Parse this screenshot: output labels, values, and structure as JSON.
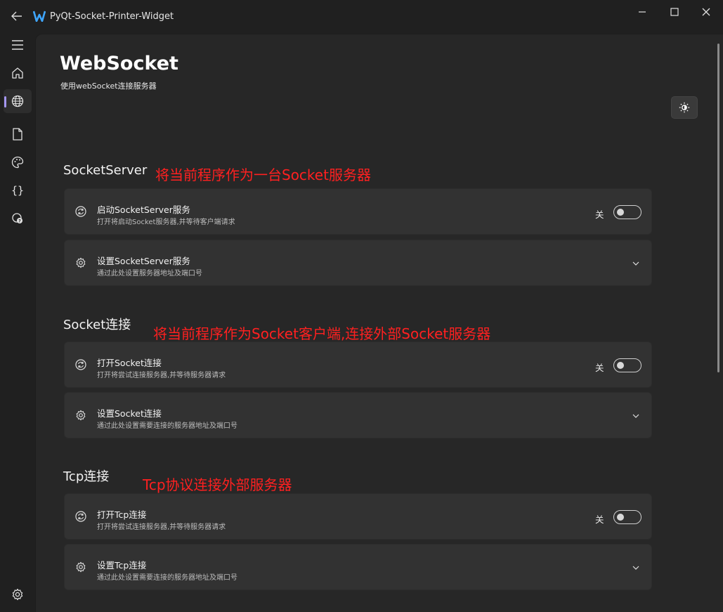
{
  "window": {
    "title": "PyQt-Socket-Printer-Widget",
    "controls": [
      "minimize-icon",
      "maximize-icon",
      "close-icon"
    ]
  },
  "nav": {
    "items": [
      {
        "icon": "menu-icon"
      },
      {
        "icon": "home-icon"
      },
      {
        "icon": "globe-icon",
        "active": true
      },
      {
        "icon": "document-icon"
      },
      {
        "icon": "palette-icon"
      },
      {
        "icon": "code-braces-icon"
      },
      {
        "icon": "chat-help-icon"
      }
    ],
    "bottom": {
      "icon": "settings-icon"
    },
    "accent": "#a597f2"
  },
  "page": {
    "title": "WebSocket",
    "subtitle": "使用webSocket连接服务器",
    "theme_button_icon": "brightness-icon"
  },
  "sections": [
    {
      "title": "SocketServer",
      "annotation": "将当前程序作为一台Socket服务器",
      "cards": [
        {
          "icon": "sync-icon",
          "title": "启动SocketServer服务",
          "desc": "打开将启动Socket服务器,并等待客户端请求",
          "control": "toggle",
          "toggle_label": "关",
          "on": false
        },
        {
          "icon": "gear-icon",
          "title": "设置SocketServer服务",
          "desc": "通过此处设置服务器地址及端口号",
          "control": "expand"
        }
      ]
    },
    {
      "title": "Socket连接",
      "annotation": "将当前程序作为Socket客户端,连接外部Socket服务器",
      "cards": [
        {
          "icon": "sync-icon",
          "title": "打开Socket连接",
          "desc": "打开将尝试连接服务器,并等待服务器请求",
          "control": "toggle",
          "toggle_label": "关",
          "on": false
        },
        {
          "icon": "gear-icon",
          "title": "设置Socket连接",
          "desc": "通过此处设置需要连接的服务器地址及端口号",
          "control": "expand"
        }
      ]
    },
    {
      "title": "Tcp连接",
      "annotation": "Tcp协议连接外部服务器",
      "cards": [
        {
          "icon": "sync-icon",
          "title": "打开Tcp连接",
          "desc": "打开将尝试连接服务器,并等待服务器请求",
          "control": "toggle",
          "toggle_label": "关",
          "on": false
        },
        {
          "icon": "gear-icon",
          "title": "设置Tcp连接",
          "desc": "通过此处设置需要连接的服务器地址及端口号",
          "control": "expand"
        }
      ]
    }
  ],
  "colors": {
    "background": "#202020",
    "panel": "#272727",
    "card": "#323232",
    "annotation": "#ff2020"
  }
}
